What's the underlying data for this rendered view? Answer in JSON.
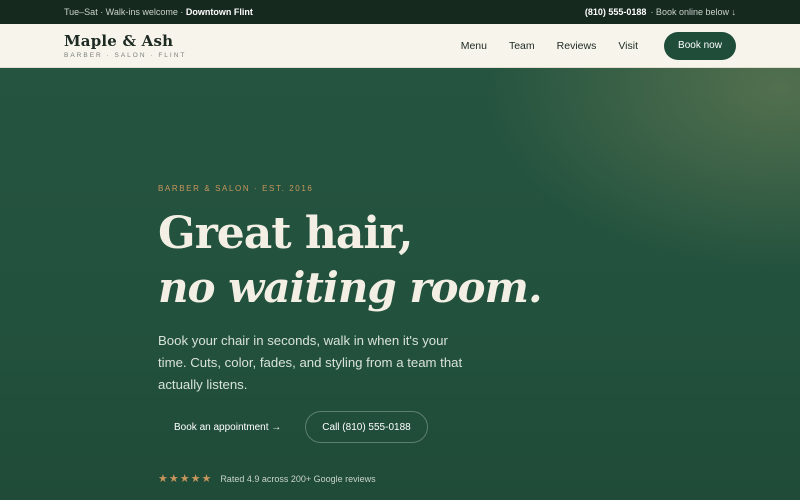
{
  "topbar": {
    "hours": "Tue–Sat · Walk-ins welcome · ",
    "location": "Downtown Flint",
    "phone": "(810) 555-0188",
    "book_online": "· Book online below ↓"
  },
  "nav": {
    "logo_name": "Maple & Ash",
    "logo_sub": "BARBER · SALON · FLINT",
    "links": [
      "Menu",
      "Team",
      "Reviews",
      "Visit"
    ],
    "book_label": "Book now"
  },
  "hero": {
    "eyebrow": "BARBER & SALON · EST. 2016",
    "headline_line1": "Great hair,",
    "headline_line2": "no waiting room.",
    "lead": "Book your chair in seconds, walk in when it's your time. Cuts, color, fades, and styling from a team that actually listens.",
    "cta_primary": "Book an appointment →",
    "cta_secondary": "Call (810) 555-0188",
    "stars": "★★★★★",
    "rating_value": 4.9,
    "rating_text": "Rated 4.9 across 200+ Google reviews"
  },
  "colors": {
    "brand_green": "#1f4d3a",
    "accent_gold": "#c8955c",
    "cream": "#f7f4ec"
  }
}
